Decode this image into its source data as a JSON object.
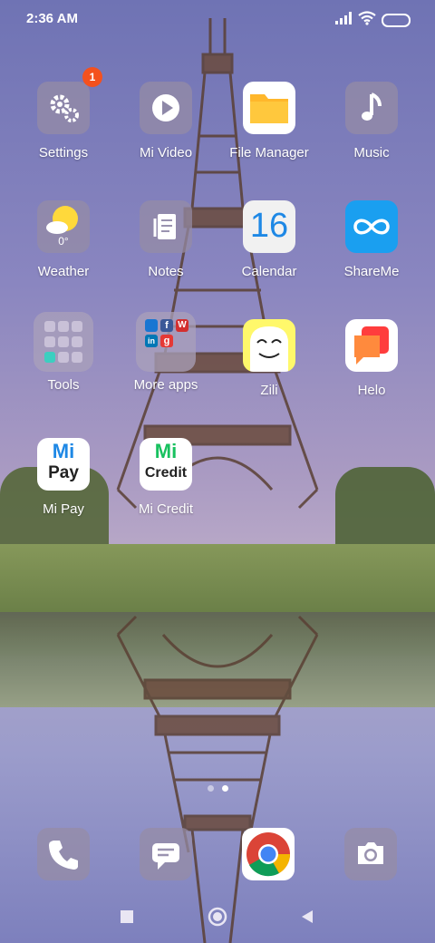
{
  "status_bar": {
    "time": "2:36 AM",
    "icons": [
      "signal-icon",
      "wifi-icon",
      "battery-icon"
    ]
  },
  "home_grid": {
    "rows": [
      [
        {
          "label": "Settings",
          "icon": "gear-icon",
          "badge": "1"
        },
        {
          "label": "Mi Video",
          "icon": "play-icon"
        },
        {
          "label": "File Manager",
          "icon": "folder-icon"
        },
        {
          "label": "Music",
          "icon": "music-note-icon"
        }
      ],
      [
        {
          "label": "Weather",
          "icon": "sun-icon",
          "icon_text": "0°"
        },
        {
          "label": "Notes",
          "icon": "notes-icon"
        },
        {
          "label": "Calendar",
          "icon": "calendar-icon",
          "icon_text": "16"
        },
        {
          "label": "ShareMe",
          "icon": "infinity-icon"
        }
      ],
      [
        {
          "label": "Tools",
          "icon": "folder-grid-icon"
        },
        {
          "label": "More apps",
          "icon": "folder-apps-icon",
          "mini_letters": [
            "f",
            "W",
            "in",
            "g"
          ]
        },
        {
          "label": "Zili",
          "icon": "smiley-face-icon"
        },
        {
          "label": "Helo",
          "icon": "chat-bubble-icon"
        }
      ],
      [
        {
          "label": "Mi Pay",
          "icon": "mi-pay-icon",
          "icon_text_top": "Mi",
          "icon_text_bottom": "Pay"
        },
        {
          "label": "Mi Credit",
          "icon": "mi-credit-icon",
          "icon_text_top": "Mi",
          "icon_text_bottom": "Credit"
        }
      ]
    ]
  },
  "page_indicator": {
    "pages": 2,
    "current": 2
  },
  "dock": [
    "phone-icon",
    "messages-icon",
    "chrome-icon",
    "camera-icon"
  ],
  "nav_bar": [
    "recents-icon",
    "home-icon",
    "back-icon"
  ],
  "colors": {
    "badge": "#f4511e",
    "file_manager": "#ffb72b",
    "shareme": "#1a9ff0",
    "calendar_number": "#1e88e5",
    "zili": "#fff86b",
    "helo": "#ff6a3d",
    "mi_green": "#18c15f"
  }
}
